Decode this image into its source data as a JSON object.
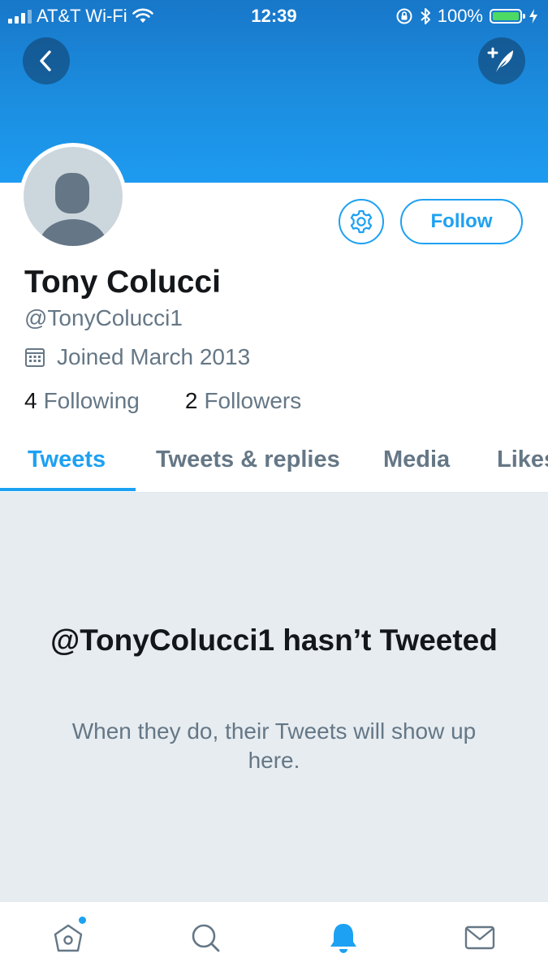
{
  "status_bar": {
    "carrier": "AT&T Wi-Fi",
    "time": "12:39",
    "battery": "100%"
  },
  "header": {
    "back_icon": "chevron-left-icon",
    "compose_icon": "compose-tweet-icon"
  },
  "profile": {
    "name": "Tony Colucci",
    "handle": "@TonyColucci1",
    "joined": "Joined March 2013",
    "following_count": "4",
    "following_label": "Following",
    "followers_count": "2",
    "followers_label": "Followers",
    "follow_label": "Follow"
  },
  "tabs": [
    {
      "label": "Tweets",
      "active": true
    },
    {
      "label": "Tweets & replies",
      "active": false
    },
    {
      "label": "Media",
      "active": false
    },
    {
      "label": "Likes",
      "active": false
    }
  ],
  "empty_state": {
    "title": "@TonyColucci1 hasn’t Tweeted",
    "subtitle": "When they do, their Tweets will show up here."
  },
  "bottom_nav": [
    {
      "icon": "home-icon",
      "active": false,
      "has_dot": true
    },
    {
      "icon": "search-icon",
      "active": false
    },
    {
      "icon": "notifications-bell-icon",
      "active": true
    },
    {
      "icon": "messages-envelope-icon",
      "active": false
    }
  ],
  "colors": {
    "accent": "#1da1f2",
    "banner": "#1c8ee0",
    "empty_bg": "#e6ecf0",
    "secondary_text": "#657786"
  }
}
